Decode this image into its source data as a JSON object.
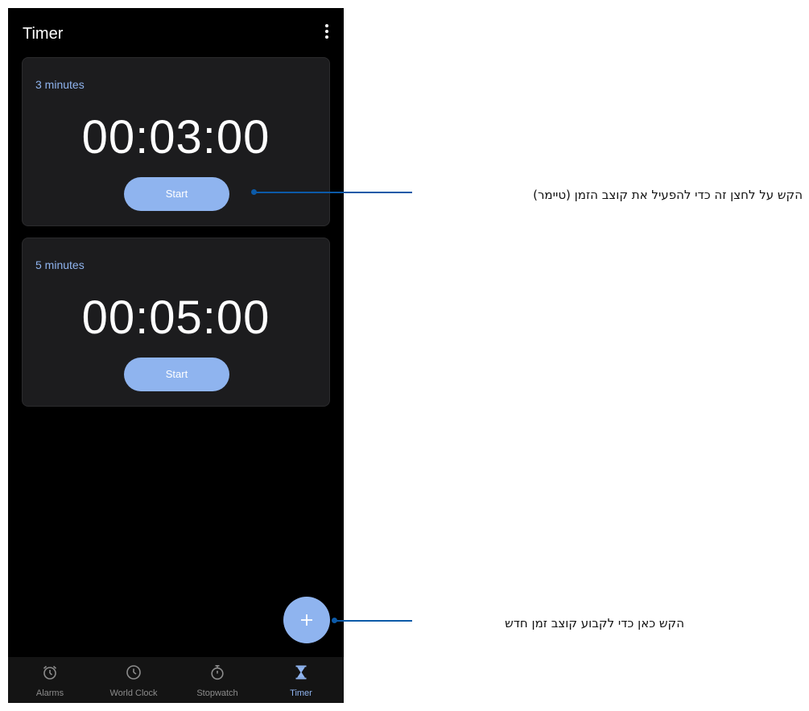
{
  "app": {
    "title": "Timer",
    "more_menu_icon": "more-vert-icon"
  },
  "timers": [
    {
      "label": "3 minutes",
      "time": "00:03:00",
      "start_label": "Start"
    },
    {
      "label": "5 minutes",
      "time": "00:05:00",
      "start_label": "Start"
    }
  ],
  "fab": {
    "icon": "plus-icon",
    "symbol": "+"
  },
  "bottom_nav": {
    "items": [
      {
        "label": "Alarms",
        "icon": "alarm-clock-icon",
        "active": false
      },
      {
        "label": "World Clock",
        "icon": "clock-icon",
        "active": false
      },
      {
        "label": "Stopwatch",
        "icon": "stopwatch-icon",
        "active": false
      },
      {
        "label": "Timer",
        "icon": "hourglass-icon",
        "active": true
      }
    ]
  },
  "annotations": {
    "start_timer": "הקש על לחצן זה כדי להפעיל את קוצב הזמן (טיימר)",
    "new_timer": "הקש כאן כדי לקבוע קוצב זמן חדש"
  },
  "colors": {
    "background": "#000000",
    "card_background": "#1c1c1e",
    "accent": "#8fb4ef",
    "nav_inactive": "#8c8c8c",
    "callout_line": "#0c5aa8"
  }
}
